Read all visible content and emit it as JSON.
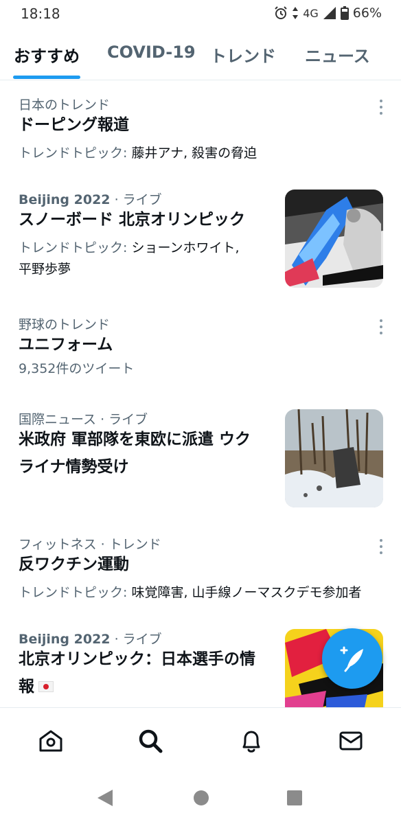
{
  "status_bar": {
    "time": "18:18",
    "network": "4G",
    "battery": "66%"
  },
  "tabs": [
    {
      "label": "おすすめ",
      "active": true
    },
    {
      "label": "COVID-19",
      "active": false
    },
    {
      "label": "トレンド",
      "active": false
    },
    {
      "label": "ニュース",
      "active": false
    }
  ],
  "items": [
    {
      "meta": "日本のトレンド",
      "title": "ドーピング報道",
      "sub_prefix": "トレンドトピック: ",
      "sub_value": "藤井アナ, 殺害の脅迫"
    },
    {
      "meta_bold": "Beijing 2022",
      "meta_rest": " · ライブ",
      "title": "スノーボード 北京オリンピック",
      "sub_prefix": "トレンドトピック: ",
      "sub_value_line1": "ショーンホワイト,",
      "sub_value_line2": "平野歩夢"
    },
    {
      "meta": "野球のトレンド",
      "title": "ユニフォーム",
      "sub": "9,352件のツイート"
    },
    {
      "meta": "国際ニュース · ライブ",
      "title_line1": "米政府 軍部隊を東欧に派遣 ウク",
      "title_line2": "ライナ情勢受け"
    },
    {
      "meta": "フィットネス · トレンド",
      "title": "反ワクチン運動",
      "sub_prefix": "トレンドトピック: ",
      "sub_value": "味覚障害, 山手線ノーマスクデモ参加者"
    },
    {
      "meta_bold": "Beijing 2022",
      "meta_rest": " · ライブ",
      "title_line1": "北京オリンピック：日本選手の情",
      "title_line2": "報"
    }
  ],
  "colors": {
    "accent": "#1d9bf0",
    "text": "#0f1419",
    "secondary": "#536471"
  },
  "icons": {
    "compose": "compose-tweet-icon",
    "nav": [
      "home-icon",
      "search-icon",
      "notifications-icon",
      "messages-icon"
    ],
    "system": [
      "back-icon",
      "home-circle-icon",
      "recents-icon"
    ]
  }
}
